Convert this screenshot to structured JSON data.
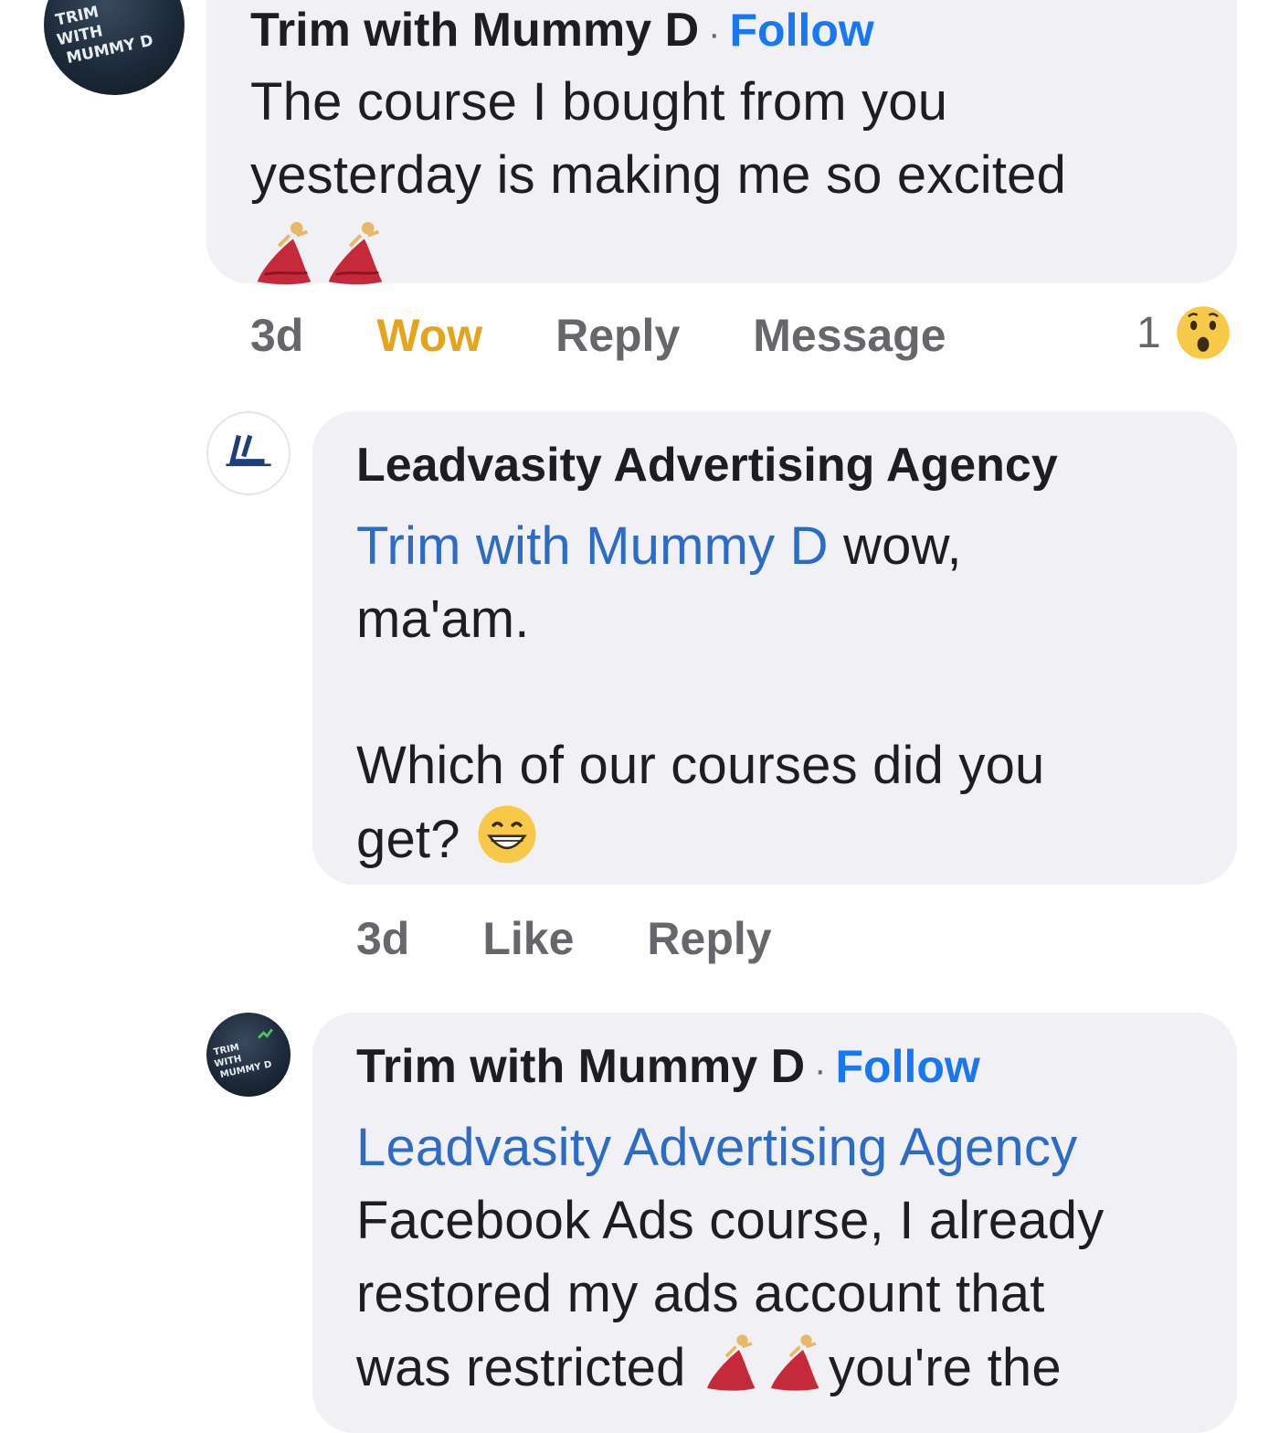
{
  "comment1": {
    "author": "Trim with Mummy D",
    "separator": "·",
    "follow": "Follow",
    "text_line1": "The course I bought from you",
    "text_line2": "yesterday is making me so excited",
    "emojis": [
      "dancer-emoji",
      "dancer-emoji"
    ],
    "time": "3d",
    "reaction_action": "Wow",
    "reply": "Reply",
    "message": "Message",
    "reaction_count": "1",
    "reaction_icon": "wow-face-emoji",
    "reaction_color": "#e5a41d"
  },
  "comment2": {
    "author": "Leadvasity Advertising Agency",
    "mention": "Trim with Mummy D",
    "text_after_mention": " wow,",
    "text_line2": "ma'am.",
    "text_para2_line1": "Which of our courses did you",
    "text_para2_line2": "get?",
    "emoji": "grinning-face-emoji",
    "time": "3d",
    "like": "Like",
    "reply": "Reply"
  },
  "comment3": {
    "author": "Trim with Mummy D",
    "separator": "·",
    "follow": "Follow",
    "mention": "Leadvasity Advertising Agency",
    "text_line1": "Facebook Ads course, I already",
    "text_line2": "restored my ads account that",
    "text_line3_start": "was restricted",
    "text_line3_end": "you're the"
  },
  "colors": {
    "bubble": "#f1f0f5",
    "link": "#1877f2",
    "mention": "#2d6bc4",
    "meta": "#65676b"
  }
}
